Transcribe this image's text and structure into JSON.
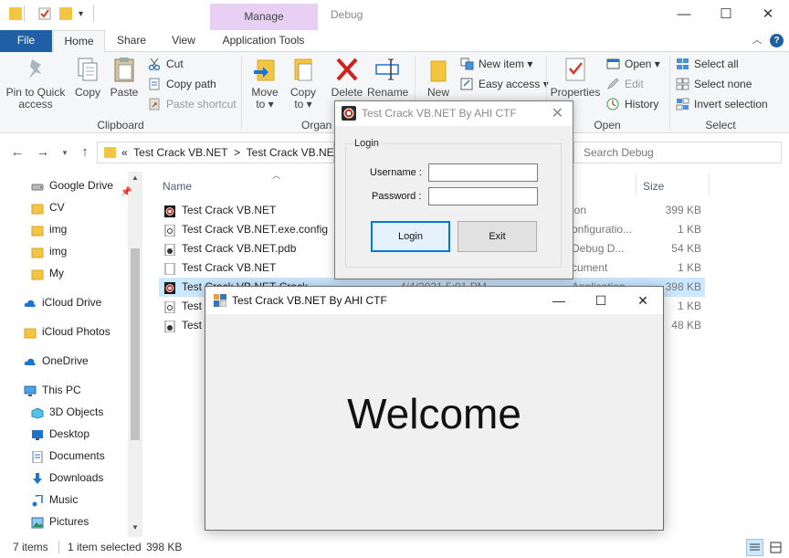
{
  "titlebar": {
    "context_tab": "Manage",
    "title": "Debug",
    "minimize": "—",
    "maximize": "☐",
    "close": "✕"
  },
  "ribbon_tabs": {
    "file": "File",
    "home": "Home",
    "share": "Share",
    "view": "View",
    "app_tools": "Application Tools",
    "help": "?"
  },
  "ribbon": {
    "clipboard": {
      "label": "Clipboard",
      "pin": [
        "Pin to Quick",
        "access"
      ],
      "copy": "Copy",
      "paste": "Paste",
      "cut": "Cut",
      "copy_path": "Copy path",
      "paste_shortcut": "Paste shortcut"
    },
    "organize": {
      "label": "Organ",
      "move_to": [
        "Move",
        "to ▾"
      ],
      "copy_to": [
        "Copy",
        "to ▾"
      ],
      "delete": "Delete",
      "rename": "Rename"
    },
    "new": {
      "new_folder": "New",
      "new_item": "New item ▾",
      "easy_access": "Easy access ▾"
    },
    "open": {
      "label": "Open",
      "properties": "Properties",
      "open": "Open ▾",
      "edit": "Edit",
      "history": "History"
    },
    "select": {
      "label": "Select",
      "select_all": "Select all",
      "select_none": "Select none",
      "invert": "Invert selection"
    }
  },
  "address": {
    "chevron": "«",
    "path1": "Test Crack VB.NET",
    "sep": ">",
    "path2": "Test Crack VB.NET",
    "search_placeholder": "Search Debug"
  },
  "nav": [
    {
      "label": "Google Drive",
      "name": "google-drive",
      "icon": "drive",
      "pinned": true
    },
    {
      "label": "CV",
      "name": "cv",
      "icon": "folder"
    },
    {
      "label": "img",
      "name": "img-1",
      "icon": "folder"
    },
    {
      "label": "img",
      "name": "img-2",
      "icon": "folder"
    },
    {
      "label": "My",
      "name": "my",
      "icon": "folder"
    },
    {
      "label": "iCloud Drive",
      "name": "icloud-drive",
      "icon": "cloud"
    },
    {
      "label": "iCloud Photos",
      "name": "icloud-photos",
      "icon": "folder"
    },
    {
      "label": "OneDrive",
      "name": "onedrive",
      "icon": "cloud"
    },
    {
      "label": "This PC",
      "name": "this-pc",
      "icon": "pc"
    },
    {
      "label": "3D Objects",
      "name": "3d-objects",
      "icon": "cube"
    },
    {
      "label": "Desktop",
      "name": "desktop",
      "icon": "desktop"
    },
    {
      "label": "Documents",
      "name": "documents",
      "icon": "doc"
    },
    {
      "label": "Downloads",
      "name": "downloads",
      "icon": "down"
    },
    {
      "label": "Music",
      "name": "music",
      "icon": "music"
    },
    {
      "label": "Pictures",
      "name": "pictures",
      "icon": "pictures"
    }
  ],
  "columns": {
    "name": "Name",
    "size": "Size"
  },
  "files": [
    {
      "name": "Test Crack VB.NET",
      "type": "ion",
      "size": "399 KB",
      "icon": "app"
    },
    {
      "name": "Test Crack VB.NET.exe.config",
      "type": "onfiguratio...",
      "size": "1 KB",
      "icon": "config"
    },
    {
      "name": "Test Crack VB.NET.pdb",
      "type": "Debug D...",
      "size": "54 KB",
      "icon": "pdb"
    },
    {
      "name": "Test Crack VB.NET",
      "type": "cument",
      "size": "1 KB",
      "icon": "text"
    },
    {
      "name": "Test Crack VB.NET-Crack",
      "date": "4/4/2021 5:01 PM",
      "type": "Application",
      "size": "398 KB",
      "icon": "app",
      "selected": true
    },
    {
      "name": "Test C",
      "type": "",
      "size": "1 KB",
      "icon": "config"
    },
    {
      "name": "Test C",
      "type": "",
      "size": "48 KB",
      "icon": "pdb"
    }
  ],
  "status": {
    "items": "7 items",
    "selected": "1 item selected",
    "size": "398 KB"
  },
  "login_dialog": {
    "title": "Test Crack VB.NET By AHI CTF",
    "close": "✕",
    "group": "Login",
    "username_label": "Username :",
    "password_label": "Password :",
    "login_button": "Login",
    "exit_button": "Exit"
  },
  "welcome_window": {
    "title": "Test Crack VB.NET By AHI CTF",
    "minimize": "—",
    "maximize": "☐",
    "close": "✕",
    "message": "Welcome"
  }
}
